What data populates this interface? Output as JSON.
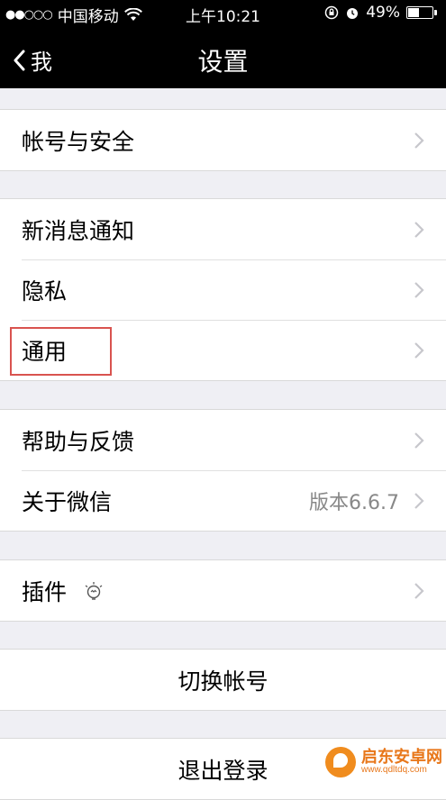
{
  "status_bar": {
    "carrier": "中国移动",
    "time": "上午10:21",
    "battery_text": "49%",
    "battery_level": 0.49
  },
  "nav": {
    "back_label": "我",
    "title": "设置"
  },
  "groups": [
    {
      "items": [
        {
          "label": "帐号与安全"
        }
      ]
    },
    {
      "items": [
        {
          "label": "新消息通知"
        },
        {
          "label": "隐私"
        },
        {
          "label": "通用"
        }
      ]
    },
    {
      "items": [
        {
          "label": "帮助与反馈"
        },
        {
          "label": "关于微信",
          "value": "版本6.6.7"
        }
      ]
    },
    {
      "items": [
        {
          "label": "插件"
        }
      ]
    },
    {
      "items": [
        {
          "label": "切换帐号"
        }
      ]
    },
    {
      "items": [
        {
          "label": "退出登录"
        }
      ]
    }
  ],
  "watermark": {
    "name": "启东安卓网",
    "url": "www.qdltdq.com"
  },
  "icons": {
    "signal": "signal-dots-icon",
    "wifi": "wifi-icon",
    "lock_rotation": "rotation-lock-icon",
    "alarm": "alarm-icon",
    "battery": "battery-icon",
    "back": "chevron-left-icon",
    "chevron": "chevron-right-icon",
    "plugin": "bulb-icon"
  },
  "colors": {
    "nav_background": "#000000",
    "page_background": "#efeff4",
    "highlight_border": "#d9534f"
  }
}
